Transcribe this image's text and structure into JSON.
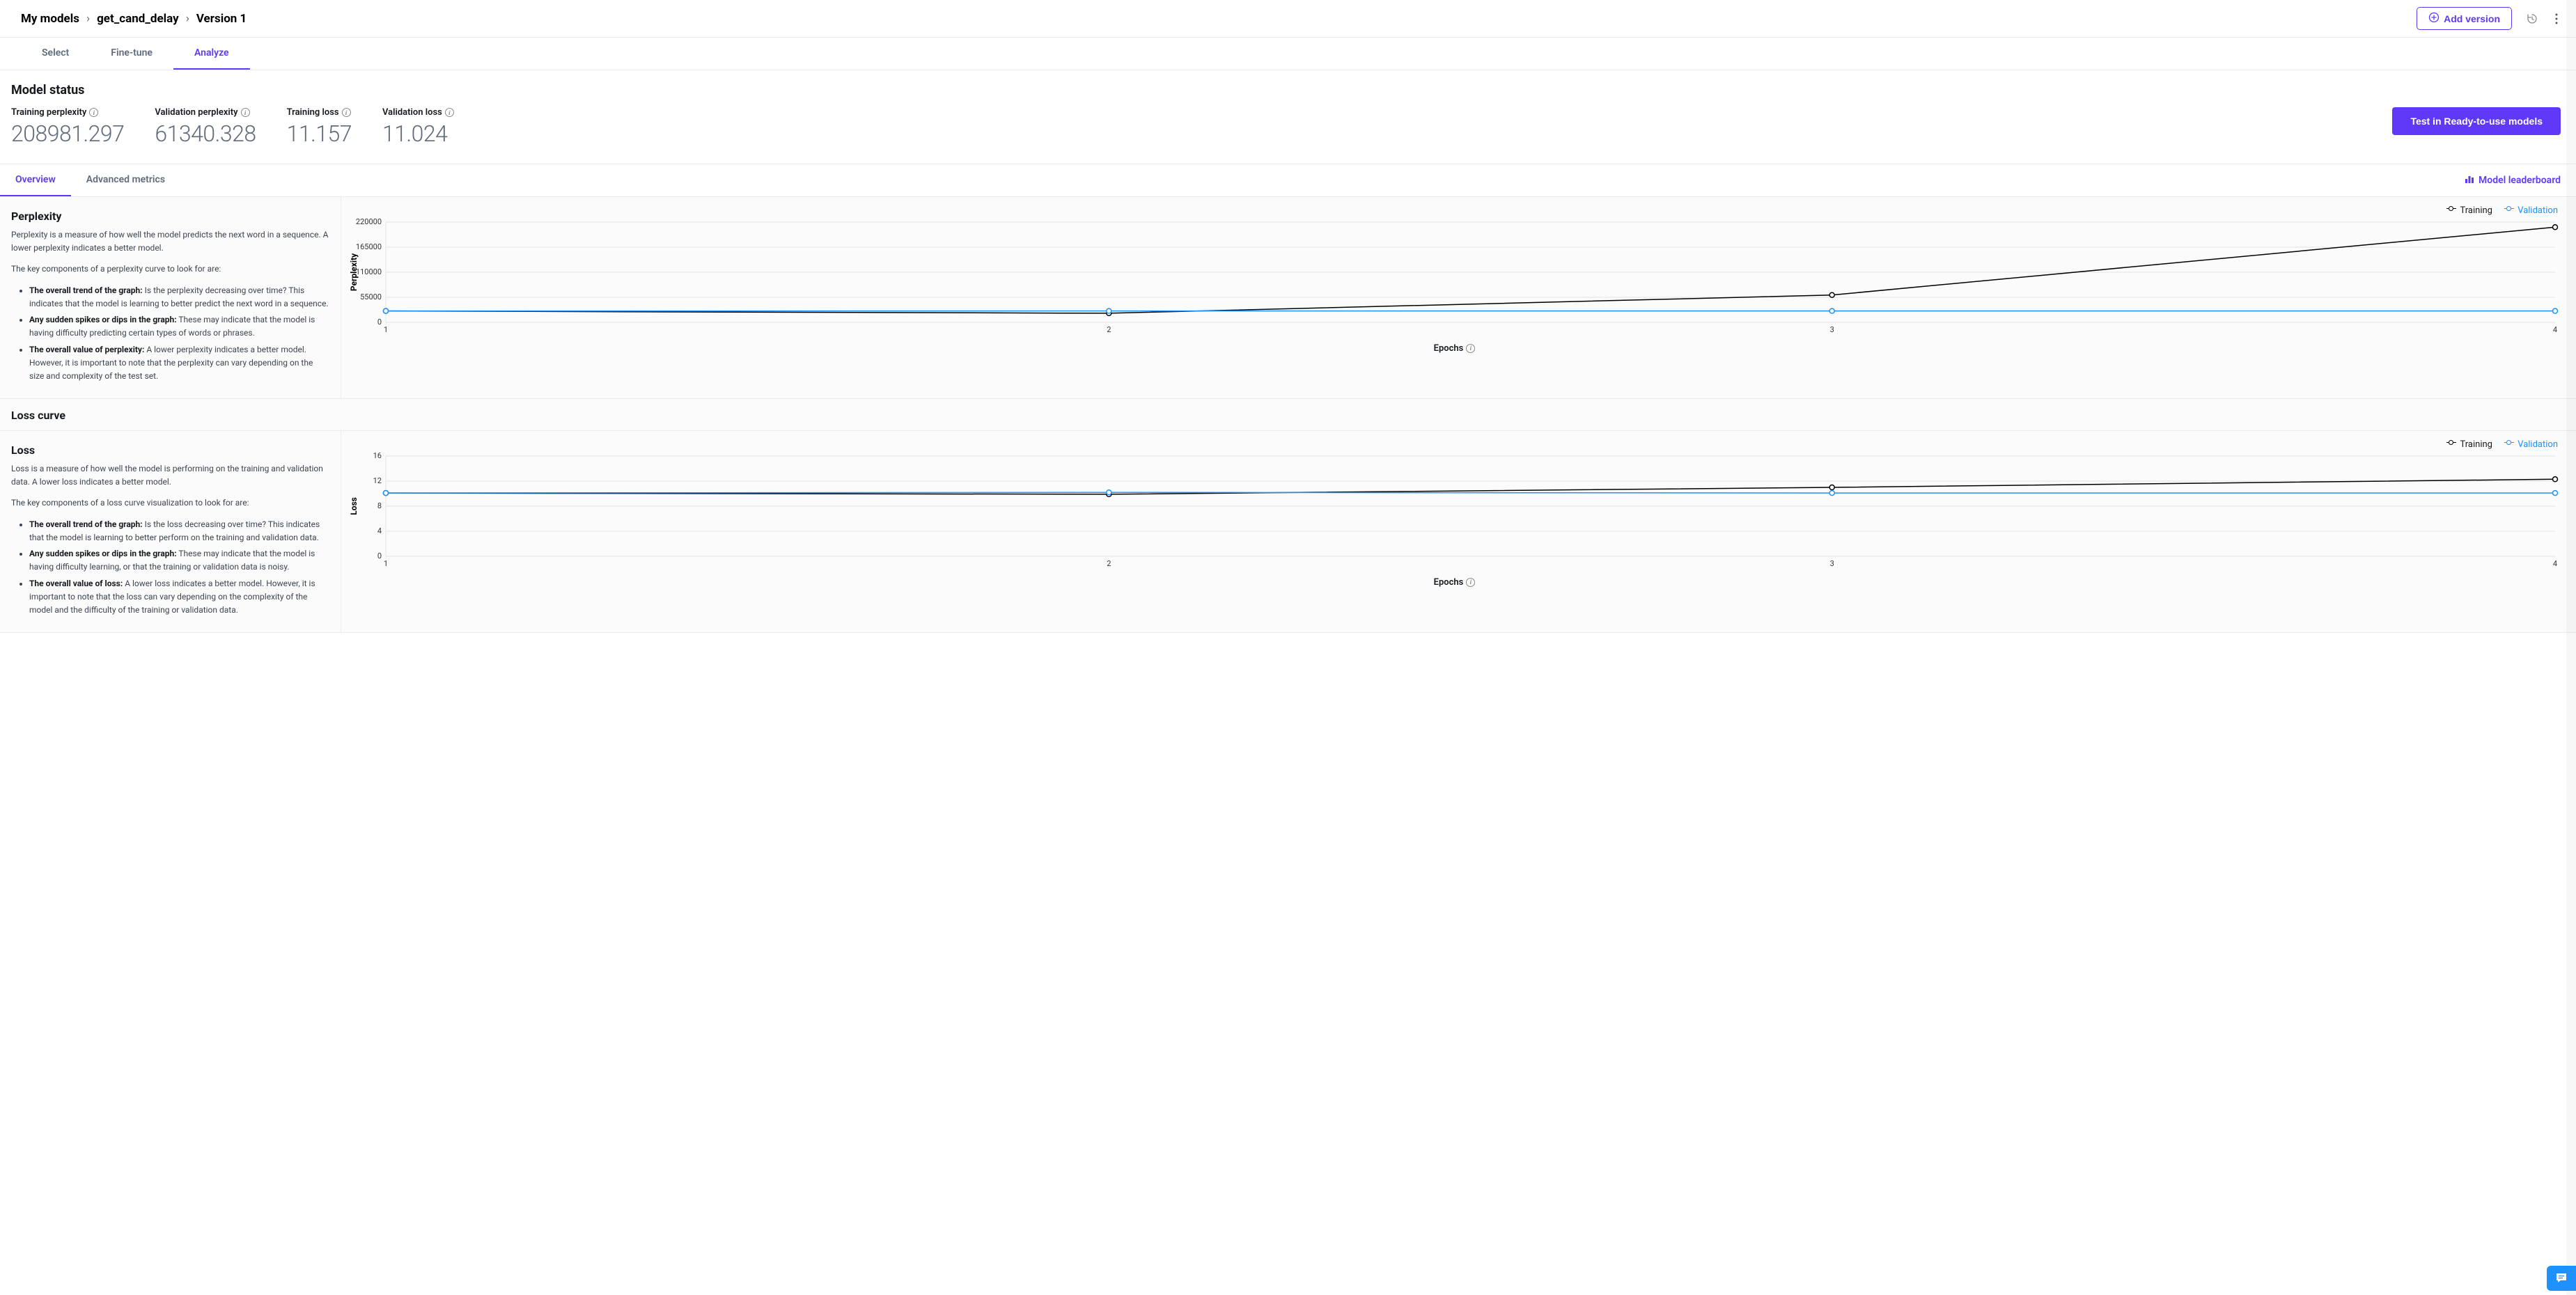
{
  "breadcrumb": [
    "My models",
    "get_cand_delay",
    "Version 1"
  ],
  "header_actions": {
    "add_version": "Add version"
  },
  "main_tabs": [
    {
      "id": "select",
      "label": "Select",
      "active": false
    },
    {
      "id": "finetune",
      "label": "Fine-tune",
      "active": false
    },
    {
      "id": "analyze",
      "label": "Analyze",
      "active": true
    }
  ],
  "status": {
    "title": "Model status",
    "metrics": [
      {
        "id": "training_perplexity",
        "label": "Training perplexity",
        "value": "208981.297"
      },
      {
        "id": "validation_perplexity",
        "label": "Validation perplexity",
        "value": "61340.328"
      },
      {
        "id": "training_loss",
        "label": "Training loss",
        "value": "11.157"
      },
      {
        "id": "validation_loss",
        "label": "Validation loss",
        "value": "11.024"
      }
    ],
    "cta": "Test in Ready-to-use models"
  },
  "sub_tabs": [
    {
      "id": "overview",
      "label": "Overview",
      "active": true
    },
    {
      "id": "advanced",
      "label": "Advanced metrics",
      "active": false
    }
  ],
  "leaderboard_link": "Model leaderboard",
  "perplexity_section": {
    "title": "Perplexity",
    "desc": "Perplexity is a measure of how well the model predicts the next word in a sequence. A lower perplexity indicates a better model.",
    "lead": "The key components of a perplexity curve to look for are:",
    "bullets": [
      {
        "b": "The overall trend of the graph:",
        "t": " Is the perplexity decreasing over time? This indicates that the model is learning to better predict the next word in a sequence."
      },
      {
        "b": "Any sudden spikes or dips in the graph:",
        "t": " These may indicate that the model is having difficulty predicting certain types of words or phrases."
      },
      {
        "b": "The overall value of perplexity:",
        "t": " A lower perplexity indicates a better model. However, it is important to note that the perplexity can vary depending on the size and complexity of the test set."
      }
    ]
  },
  "loss_curve_title": "Loss curve",
  "loss_section": {
    "title": "Loss",
    "desc": "Loss is a measure of how well the model is performing on the training and validation data. A lower loss indicates a better model.",
    "lead": "The key components of a loss curve visualization to look for are:",
    "bullets": [
      {
        "b": "The overall trend of the graph:",
        "t": " Is the loss decreasing over time? This indicates that the model is learning to better perform on the training and validation data."
      },
      {
        "b": "Any sudden spikes or dips in the graph:",
        "t": " These may indicate that the model is having difficulty learning, or that the training or validation data is noisy."
      },
      {
        "b": "The overall value of loss:",
        "t": " A lower loss indicates a better model. However, it is important to note that the loss can vary depending on the complexity of the model and the difficulty of the training or validation data."
      }
    ]
  },
  "legend": {
    "training": "Training",
    "validation": "Validation"
  },
  "axis_x_label": "Epochs",
  "chart_data": [
    {
      "id": "perplexity",
      "type": "line",
      "xlabel": "Epochs",
      "ylabel": "Perplexity",
      "xlim": [
        1,
        4
      ],
      "ylim": [
        0,
        220000
      ],
      "yticks": [
        0,
        55000,
        110000,
        165000,
        220000
      ],
      "xticks": [
        1,
        2,
        3,
        4
      ],
      "series": [
        {
          "name": "Training",
          "x": [
            1,
            2,
            3,
            4
          ],
          "values": [
            25000,
            20000,
            60000,
            208981
          ]
        },
        {
          "name": "Validation",
          "x": [
            1,
            2,
            3,
            4
          ],
          "values": [
            25000,
            25000,
            25000,
            25000
          ]
        }
      ]
    },
    {
      "id": "loss",
      "type": "line",
      "xlabel": "Epochs",
      "ylabel": "Loss",
      "xlim": [
        1,
        4
      ],
      "ylim": [
        0,
        16
      ],
      "yticks": [
        0,
        4,
        8,
        12,
        16
      ],
      "xticks": [
        1,
        2,
        3,
        4
      ],
      "series": [
        {
          "name": "Training",
          "x": [
            1,
            2,
            3,
            4
          ],
          "values": [
            10.1,
            9.9,
            11.0,
            12.3
          ]
        },
        {
          "name": "Validation",
          "x": [
            1,
            2,
            3,
            4
          ],
          "values": [
            10.1,
            10.2,
            10.1,
            10.1
          ]
        }
      ]
    }
  ]
}
